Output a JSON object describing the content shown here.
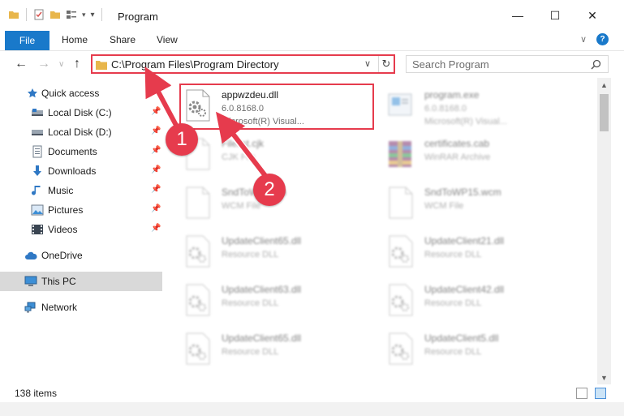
{
  "window": {
    "title": "Program",
    "minimize_glyph": "—",
    "maximize_glyph": "☐",
    "close_glyph": "✕"
  },
  "ribbon": {
    "file_label": "File",
    "tabs": [
      "Home",
      "Share",
      "View"
    ],
    "help_glyph": "?"
  },
  "address": {
    "path": "C:\\Program Files\\Program Directory",
    "search_placeholder": "Search Program"
  },
  "sidebar": {
    "items": [
      {
        "label": "Quick access",
        "icon": "star-icon"
      },
      {
        "label": "Local Disk (C:)",
        "icon": "drive-icon"
      },
      {
        "label": "Local Disk (D:)",
        "icon": "drive-icon"
      },
      {
        "label": "Documents",
        "icon": "documents-icon"
      },
      {
        "label": "Downloads",
        "icon": "download-icon"
      },
      {
        "label": "Music",
        "icon": "music-icon"
      },
      {
        "label": "Pictures",
        "icon": "pictures-icon"
      },
      {
        "label": "Videos",
        "icon": "videos-icon"
      },
      {
        "label": "OneDrive",
        "icon": "cloud-icon"
      },
      {
        "label": "This PC",
        "icon": "computer-icon"
      },
      {
        "label": "Network",
        "icon": "network-icon"
      }
    ]
  },
  "files": [
    {
      "name": "appwzdeu.dll",
      "line1": "6.0.8168.0",
      "line2": "Microsoft(R) Visual...",
      "icon": "dll-gear-icon"
    },
    {
      "name": "program.exe",
      "line1": "6.0.8168.0",
      "line2": "Microsoft(R) Visual...",
      "icon": "exe-icon"
    },
    {
      "name": "Filelist.cjk",
      "line1": "CJK File",
      "line2": "",
      "icon": "document-icon"
    },
    {
      "name": "certificates.cab",
      "line1": "WinRAR Archive",
      "line2": "",
      "icon": "winrar-icon"
    },
    {
      "name": "SndToWP.wcm",
      "line1": "WCM File",
      "line2": "",
      "icon": "document-icon"
    },
    {
      "name": "SndToWP15.wcm",
      "line1": "WCM File",
      "line2": "",
      "icon": "document-icon"
    },
    {
      "name": "UpdateClient65.dll",
      "line1": "Resource DLL",
      "line2": "",
      "icon": "dll-gear-icon"
    },
    {
      "name": "UpdateClient21.dll",
      "line1": "Resource DLL",
      "line2": "",
      "icon": "dll-gear-icon"
    },
    {
      "name": "UpdateClient63.dll",
      "line1": "Resource DLL",
      "line2": "",
      "icon": "dll-gear-icon"
    },
    {
      "name": "UpdateClient42.dll",
      "line1": "Resource DLL",
      "line2": "",
      "icon": "dll-gear-icon"
    },
    {
      "name": "UpdateClient65.dll",
      "line1": "Resource DLL",
      "line2": "",
      "icon": "dll-gear-icon"
    },
    {
      "name": "UpdateClient5.dll",
      "line1": "Resource DLL",
      "line2": "",
      "icon": "dll-gear-icon"
    }
  ],
  "status": {
    "item_count": "138 items"
  },
  "annotations": {
    "step1": "1",
    "step2": "2",
    "color": "#e63b4d"
  }
}
